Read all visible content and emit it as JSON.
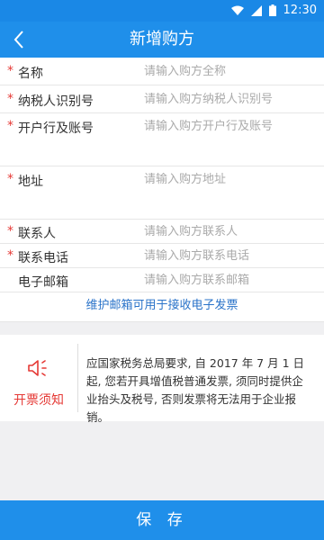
{
  "status": {
    "time": "12:30"
  },
  "header": {
    "title": "新增购方"
  },
  "form": {
    "fields": [
      {
        "label": "名称",
        "required": true,
        "placeholder": "请输入购方全称"
      },
      {
        "label": "纳税人识别号",
        "required": true,
        "placeholder": "请输入购方纳税人识别号"
      },
      {
        "label": "开户行及账号",
        "required": true,
        "placeholder": "请输入购方开户行及账号"
      },
      {
        "label": "地址",
        "required": true,
        "placeholder": "请输入购方地址"
      },
      {
        "label": "联系人",
        "required": true,
        "placeholder": "请输入购方联系人"
      },
      {
        "label": "联系电话",
        "required": true,
        "placeholder": "请输入购方联系电话"
      },
      {
        "label": "电子邮箱",
        "required": false,
        "placeholder": "请输入购方联系邮箱"
      }
    ],
    "email_link": "维护邮箱可用于接收电子发票"
  },
  "notice": {
    "title": "开票须知",
    "text": "应国家税务总局要求, 自 2017 年 7 月 1 日起, 您若开具增值税普通发票, 须同时提供企业抬头及税号, 否则发票将无法用于企业报销。"
  },
  "footer": {
    "save_label": "保 存"
  },
  "colors": {
    "primary": "#1f8fea",
    "required": "#e53935",
    "link": "#2a73c9"
  }
}
